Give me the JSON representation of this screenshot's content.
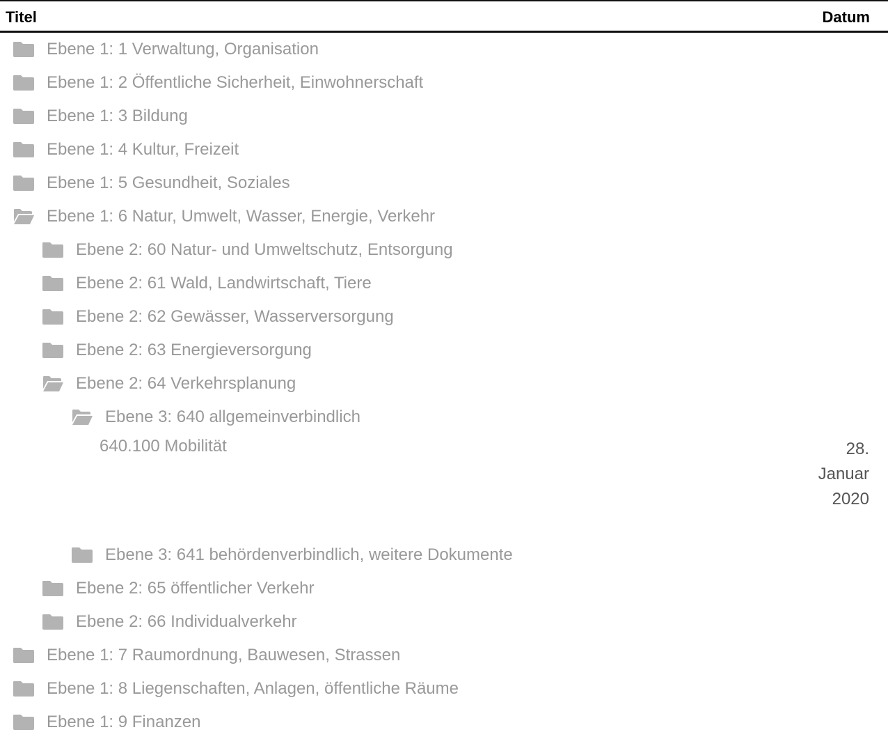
{
  "header": {
    "title_label": "Titel",
    "date_label": "Datum"
  },
  "colors": {
    "folder": "#b3b3b3",
    "text": "#999999",
    "date": "#555555"
  },
  "tree": {
    "l1_1": {
      "label": "Ebene 1: 1 Verwaltung, Organisation",
      "icon": "folder-closed-icon"
    },
    "l1_2": {
      "label": "Ebene 1: 2 Öffentliche Sicherheit, Einwohnerschaft",
      "icon": "folder-closed-icon"
    },
    "l1_3": {
      "label": "Ebene 1: 3 Bildung",
      "icon": "folder-closed-icon"
    },
    "l1_4": {
      "label": "Ebene 1: 4 Kultur, Freizeit",
      "icon": "folder-closed-icon"
    },
    "l1_5": {
      "label": "Ebene 1: 5 Gesundheit, Soziales",
      "icon": "folder-closed-icon"
    },
    "l1_6": {
      "label": "Ebene 1: 6 Natur, Umwelt, Wasser, Energie, Verkehr",
      "icon": "folder-open-icon",
      "children": {
        "l2_60": {
          "label": "Ebene 2: 60 Natur- und Umweltschutz, Entsorgung",
          "icon": "folder-closed-icon"
        },
        "l2_61": {
          "label": "Ebene 2: 61 Wald, Landwirtschaft, Tiere",
          "icon": "folder-closed-icon"
        },
        "l2_62": {
          "label": "Ebene 2: 62 Gewässer, Wasserversorgung",
          "icon": "folder-closed-icon"
        },
        "l2_63": {
          "label": "Ebene 2: 63 Energieversorgung",
          "icon": "folder-closed-icon"
        },
        "l2_64": {
          "label": "Ebene 2: 64 Verkehrsplanung",
          "icon": "folder-open-icon",
          "children": {
            "l3_640": {
              "label": "Ebene 3: 640 allgemeinverbindlich",
              "icon": "folder-open-icon",
              "document": {
                "title": "640.100 Mobilität",
                "date_day": "28.",
                "date_month": "Januar",
                "date_year": "2020"
              }
            },
            "l3_641": {
              "label": "Ebene 3: 641 behördenverbindlich, weitere Dokumente",
              "icon": "folder-closed-icon"
            }
          }
        },
        "l2_65": {
          "label": "Ebene 2: 65 öffentlicher Verkehr",
          "icon": "folder-closed-icon"
        },
        "l2_66": {
          "label": "Ebene 2: 66 Individualverkehr",
          "icon": "folder-closed-icon"
        }
      }
    },
    "l1_7": {
      "label": "Ebene 1: 7 Raumordnung, Bauwesen, Strassen",
      "icon": "folder-closed-icon"
    },
    "l1_8": {
      "label": "Ebene 1: 8 Liegenschaften, Anlagen, öffentliche Räume",
      "icon": "folder-closed-icon"
    },
    "l1_9": {
      "label": "Ebene 1: 9 Finanzen",
      "icon": "folder-closed-icon"
    }
  }
}
